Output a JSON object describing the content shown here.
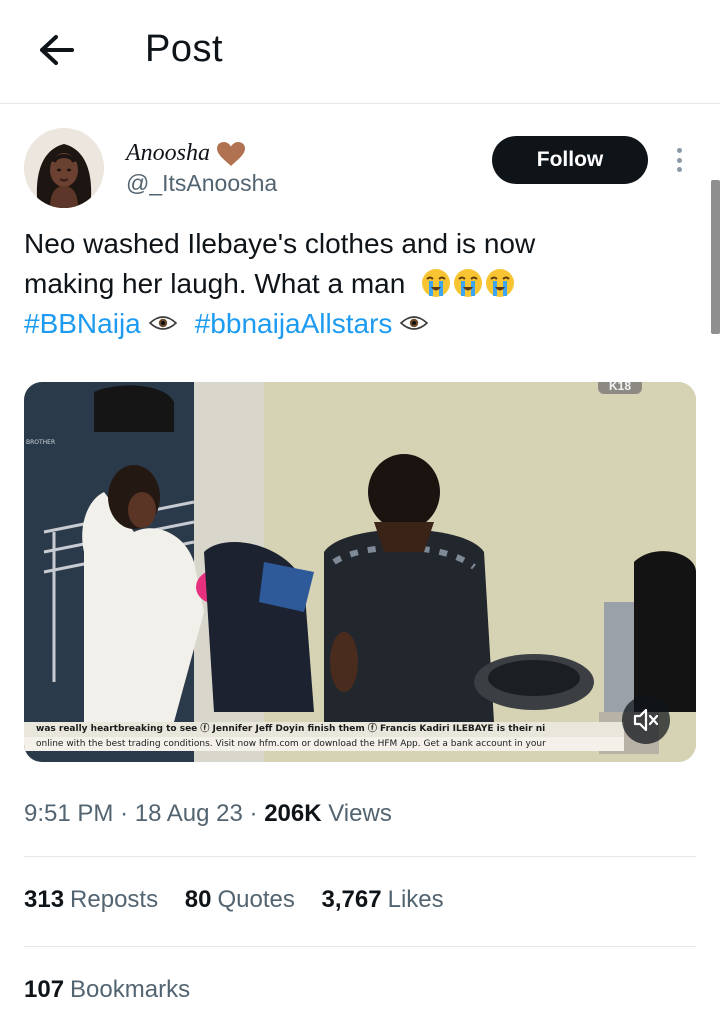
{
  "header": {
    "title": "Post",
    "back_icon": "arrow-left-icon"
  },
  "author": {
    "display_name": "Anoosha",
    "name_emoji": "brown-heart-icon",
    "handle": "@_ItsAnoosha",
    "follow_label": "Follow",
    "more_icon": "more-vertical-icon"
  },
  "tweet": {
    "line1": "Neo washed Ilebaye's clothes and is now",
    "line2": "making her laugh. What a man",
    "line2_emojis": [
      "crying-face-icon",
      "crying-face-icon",
      "crying-face-icon"
    ],
    "hashtag1": "#BBNaija",
    "hashtag2": "#bbnaijaAllstars",
    "hashtag_emoji": "eye-icon"
  },
  "media": {
    "corner_tag": "K18",
    "ticker_line1": "was really heartbreaking to see   ⓕ Jennifer Jeff Doyin finish them   ⓕ Francis Kadiri ILEBAYE is their ni",
    "ticker_line2": "online with the best trading conditions. Visit now hfm.com or download the HFM App.   Get a bank account in your",
    "mute_icon": "speaker-muted-icon"
  },
  "meta": {
    "time": "9:51 PM",
    "sep1": "·",
    "date": "18 Aug 23",
    "sep2": "·",
    "views_count": "206K",
    "views_label": "Views"
  },
  "stats": {
    "reposts_count": "313",
    "reposts_label": "Reposts",
    "quotes_count": "80",
    "quotes_label": "Quotes",
    "likes_count": "3,767",
    "likes_label": "Likes",
    "bookmarks_count": "107",
    "bookmarks_label": "Bookmarks"
  },
  "colors": {
    "link": "#1d9bf0",
    "text": "#0f1419",
    "secondary": "#536471",
    "button_bg": "#0f1419",
    "heart": "#b07250"
  }
}
